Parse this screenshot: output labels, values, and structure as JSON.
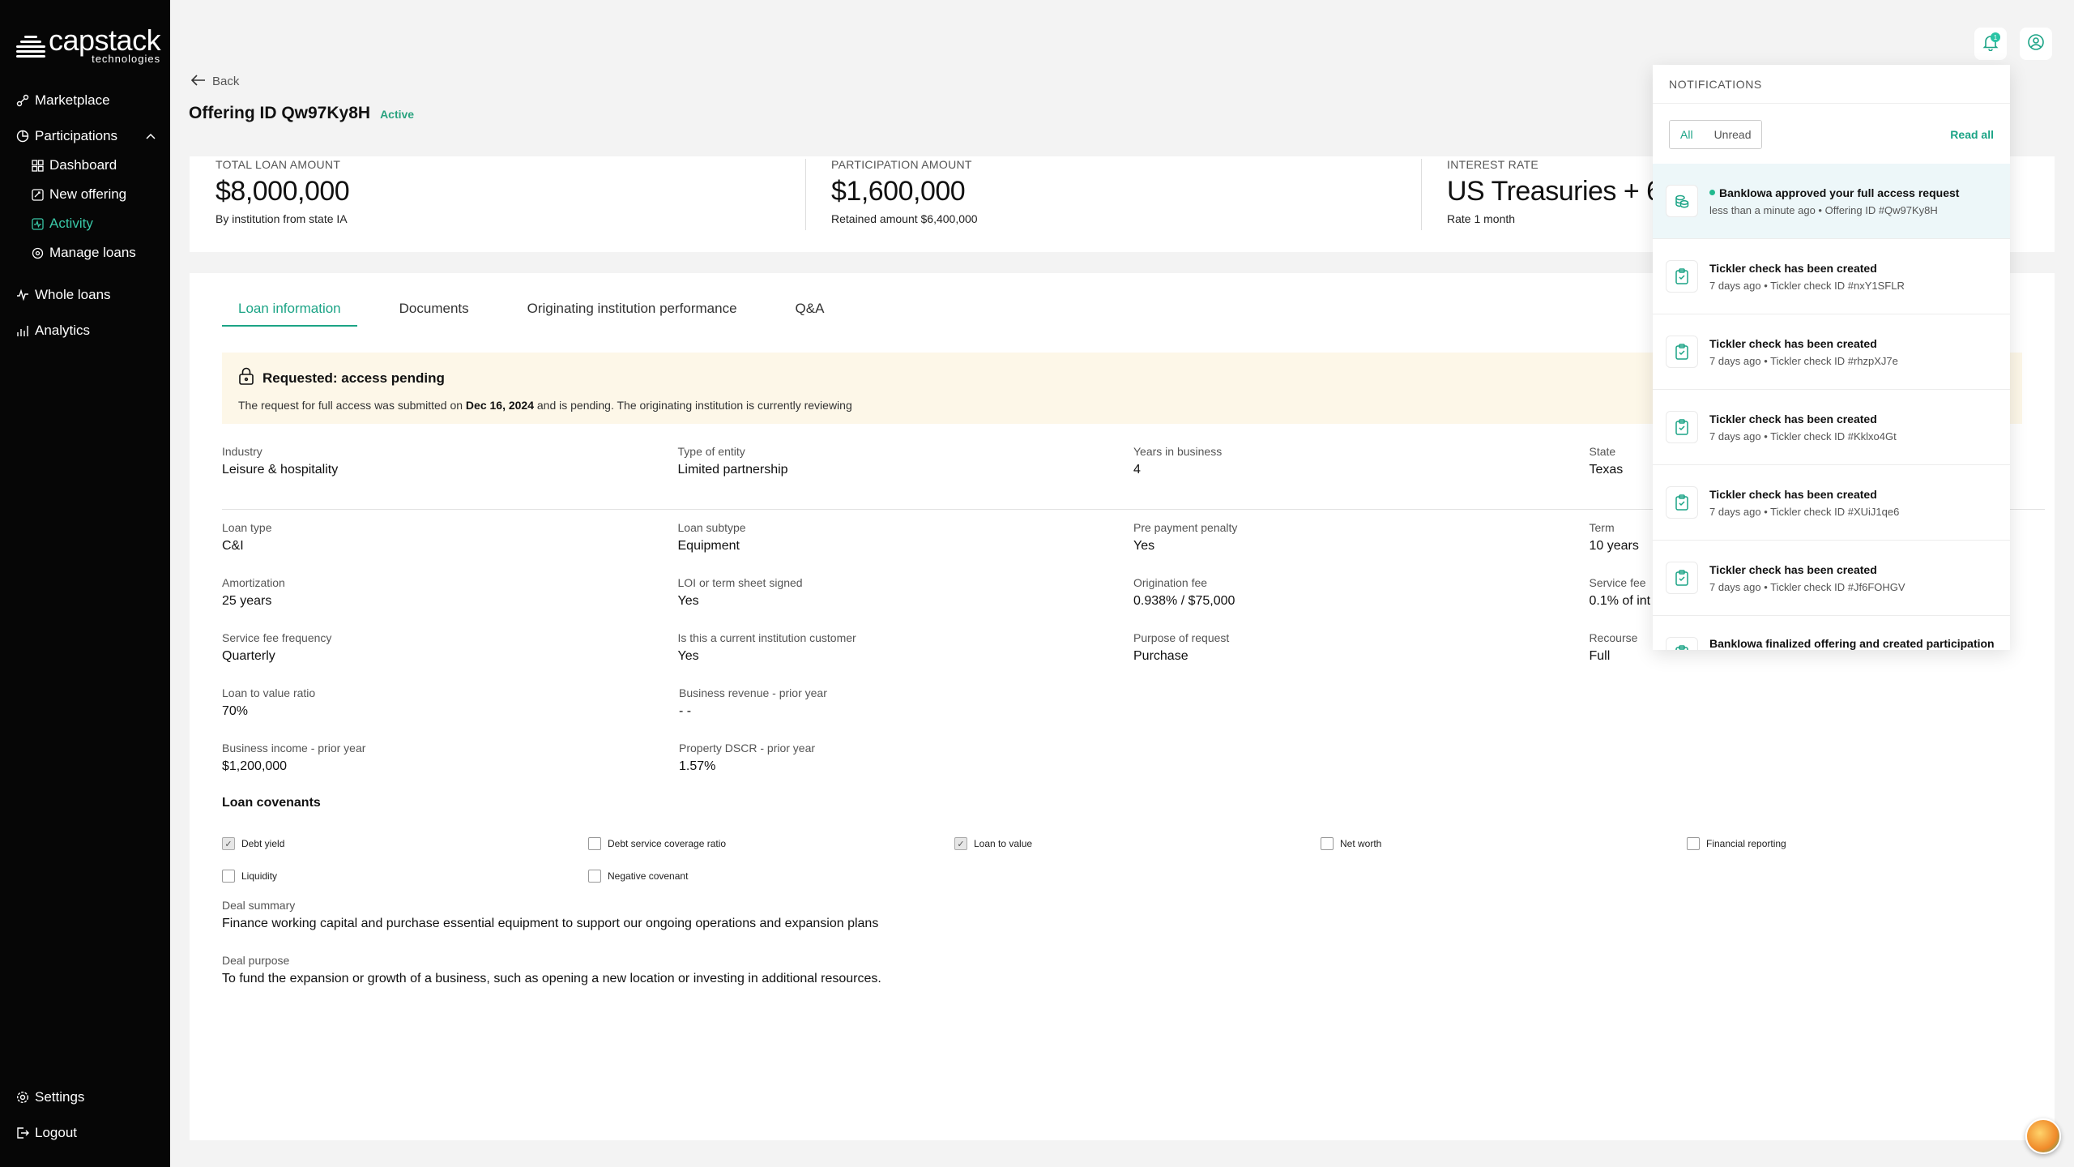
{
  "brand": {
    "name": "capstack",
    "tagline": "technologies"
  },
  "nav": {
    "marketplace": "Marketplace",
    "participations": "Participations",
    "dashboard": "Dashboard",
    "new_offering": "New offering",
    "activity": "Activity",
    "manage_loans": "Manage loans",
    "whole_loans": "Whole loans",
    "analytics": "Analytics",
    "settings": "Settings",
    "logout": "Logout"
  },
  "header": {
    "back": "Back",
    "title": "Offering ID Qw97Ky8H",
    "status": "Active",
    "notification_count": "1"
  },
  "summary": [
    {
      "label": "TOTAL LOAN AMOUNT",
      "value": "$8,000,000",
      "sub": "By institution from state IA"
    },
    {
      "label": "PARTICIPATION AMOUNT",
      "value": "$1,600,000",
      "sub": "Retained amount $6,400,000"
    },
    {
      "label": "INTEREST RATE",
      "value": "US Treasuries + 6",
      "sub": "Rate 1 month"
    }
  ],
  "tabs": [
    "Loan information",
    "Documents",
    "Originating institution performance",
    "Q&A"
  ],
  "pending": {
    "title": "Requested: access pending",
    "text_before": "The request for full access was submitted on ",
    "date": "Dec 16, 2024",
    "text_after": " and is pending. The originating institution is currently reviewing"
  },
  "fields": [
    [
      {
        "label": "Industry",
        "value": "Leisure & hospitality"
      },
      {
        "label": "Type of entity",
        "value": "Limited partnership"
      },
      {
        "label": "Years in business",
        "value": "4"
      },
      {
        "label": "State",
        "value": "Texas"
      }
    ],
    [
      {
        "label": "Loan type",
        "value": "C&I"
      },
      {
        "label": "Loan subtype",
        "value": "Equipment"
      },
      {
        "label": "Pre payment penalty",
        "value": "Yes"
      },
      {
        "label": "Term",
        "value": "10 years"
      }
    ],
    [
      {
        "label": "Amortization",
        "value": "25 years"
      },
      {
        "label": "LOI or term sheet signed",
        "value": "Yes"
      },
      {
        "label": "Origination fee",
        "value": "0.938% / $75,000"
      },
      {
        "label": "Service fee",
        "value": "0.1% of int"
      }
    ],
    [
      {
        "label": "Service fee frequency",
        "value": "Quarterly"
      },
      {
        "label": "Is this a current institution customer",
        "value": "Yes"
      },
      {
        "label": "Purpose of request",
        "value": "Purchase"
      },
      {
        "label": "Recourse",
        "value": "Full"
      }
    ],
    [
      {
        "label": "Loan to value ratio",
        "value": "70%"
      },
      {
        "label": "Business revenue - prior year",
        "value": "- -"
      }
    ],
    [
      {
        "label": "Business income - prior year",
        "value": "$1,200,000"
      },
      {
        "label": "Property DSCR - prior year",
        "value": "1.57%"
      }
    ]
  ],
  "covenants": {
    "title": "Loan covenants",
    "rows": [
      [
        {
          "label": "Debt yield",
          "checked": true
        },
        {
          "label": "Debt service coverage ratio",
          "checked": false
        },
        {
          "label": "Loan to value",
          "checked": true
        },
        {
          "label": "Net worth",
          "checked": false
        },
        {
          "label": "Financial reporting",
          "checked": false
        }
      ],
      [
        {
          "label": "Liquidity",
          "checked": false
        },
        {
          "label": "Negative covenant",
          "checked": false
        }
      ]
    ]
  },
  "deal": {
    "summary_label": "Deal summary",
    "summary_value": "Finance working capital and purchase essential equipment to support our ongoing operations and expansion plans",
    "purpose_label": "Deal purpose",
    "purpose_value": "To fund the expansion or growth of a business, such as opening a new location or investing in additional resources."
  },
  "notifications": {
    "title": "NOTIFICATIONS",
    "filter_all": "All",
    "filter_unread": "Unread",
    "read_all": "Read all",
    "items": [
      {
        "title": "BankIowa approved your full access request",
        "time": "less than a minute ago",
        "ref": "Offering ID #Qw97Ky8H",
        "unread": true
      },
      {
        "title": "Tickler check has been created",
        "time": "7 days ago",
        "ref": "Tickler check ID #nxY1SFLR",
        "unread": false
      },
      {
        "title": "Tickler check has been created",
        "time": "7 days ago",
        "ref": "Tickler check ID #rhzpXJ7e",
        "unread": false
      },
      {
        "title": "Tickler check has been created",
        "time": "7 days ago",
        "ref": "Tickler check ID #Kklxo4Gt",
        "unread": false
      },
      {
        "title": "Tickler check has been created",
        "time": "7 days ago",
        "ref": "Tickler check ID #XUiJ1qe6",
        "unread": false
      },
      {
        "title": "Tickler check has been created",
        "time": "7 days ago",
        "ref": "Tickler check ID #Jf6FOHGV",
        "unread": false
      },
      {
        "title": "BankIowa finalized offering and created participation",
        "time": "",
        "ref": "",
        "unread": false
      }
    ]
  },
  "colors": {
    "accent": "#1ca486",
    "sidebar": "#060606",
    "pending_bg": "#fdf7e8"
  }
}
